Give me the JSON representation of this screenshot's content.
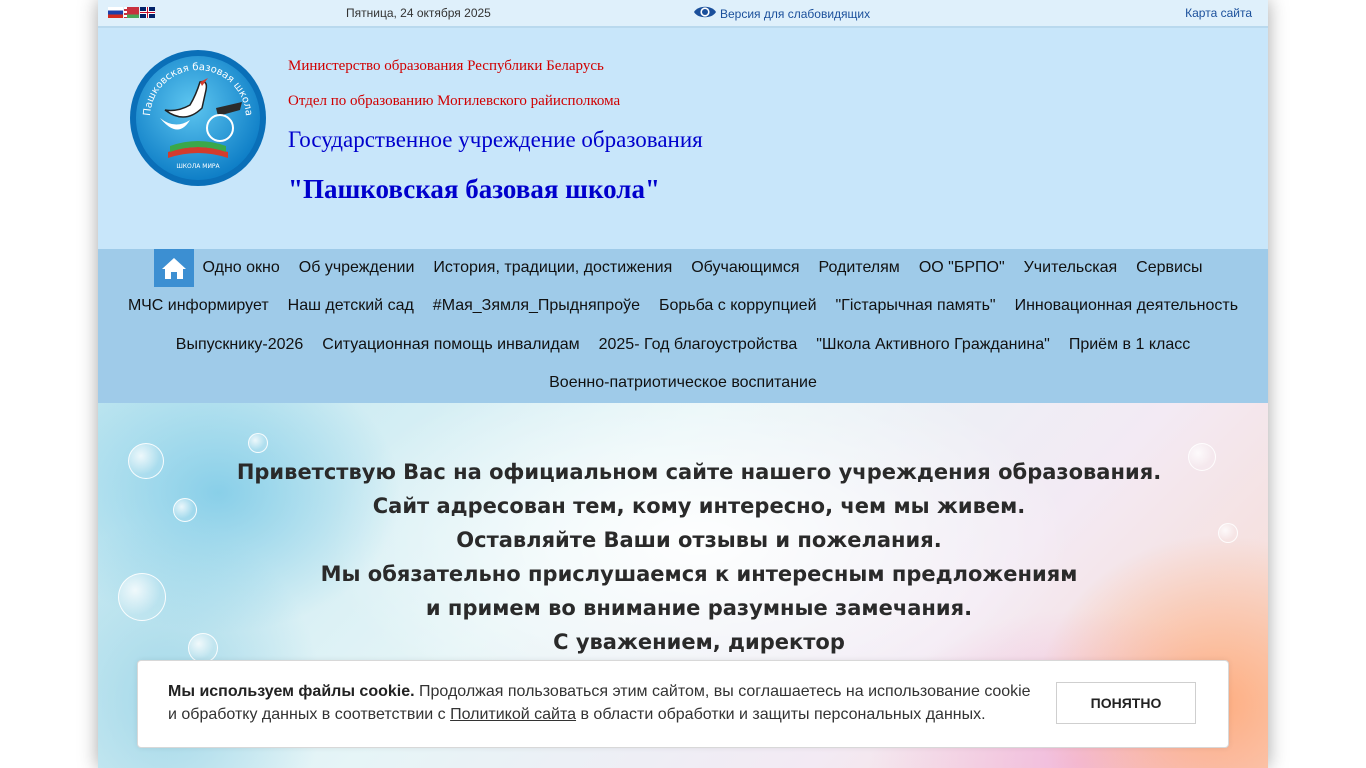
{
  "topbar": {
    "languages": [
      "Русский",
      "Беларуская",
      "English"
    ],
    "date": "Пятница, 24 октября 2025",
    "accessibility_label": "Версия для слабовидящих",
    "sitemap_label": "Карта сайта"
  },
  "header": {
    "logo_text_top": "Пашковская базовая школа",
    "logo_text_bottom": "ШКОЛА МИРА",
    "line1": "Министерство образования Республики Беларусь",
    "line2": "Отдел по образованию Могилевского райисполкома",
    "line3": "Государственное учреждение образования",
    "line4": "\"Пашковская базовая школа\""
  },
  "nav": {
    "row1": [
      "Одно окно",
      "Об учреждении",
      "История, традиции, достижения",
      "Обучающимся",
      "Родителям",
      "ОО \"БРПО\"",
      "Учительская",
      "Сервисы"
    ],
    "row2": [
      "МЧС информирует",
      "Наш детский сад",
      "#Мая_Зямля_Прыдняпроўе",
      "Борьба с коррупцией",
      "\"Гістарычная память\"",
      "Инновационная деятельность"
    ],
    "row3": [
      "Выпускнику-2026",
      "Ситуационная помощь инвалидам",
      "2025- Год благоустройства",
      "\"Школа Активного Гражданина\"",
      "Приём в 1 класс"
    ],
    "row4": [
      "Военно-патриотическое воспитание"
    ]
  },
  "banner": {
    "lines": [
      "Приветствую Вас на официальном сайте нашего учреждения образования.",
      "Сайт адресован тем,  кому интересно, чем мы живем.",
      "Оставляйте Ваши отзывы и пожелания.",
      "Мы обязательно прислушаемся к интересным предложениям",
      "и примем во внимание разумные замечания.",
      "С уважением, директор"
    ]
  },
  "cookie": {
    "bold": "Мы используем файлы cookie.",
    "text1": " Продолжая пользоваться этим сайтом, вы соглашаетесь на использование cookie и обработку данных в соответствии с ",
    "link": "Политикой сайта",
    "text2": " в области обработки и защиты персональных данных.",
    "button": "ПОНЯТНО"
  },
  "colors": {
    "header_bg": "#c8e6fa",
    "nav_bg": "#9fcbe9",
    "home_button": "#3c8fd2",
    "ministry_red": "#d00000",
    "title_blue": "#0000cc"
  }
}
